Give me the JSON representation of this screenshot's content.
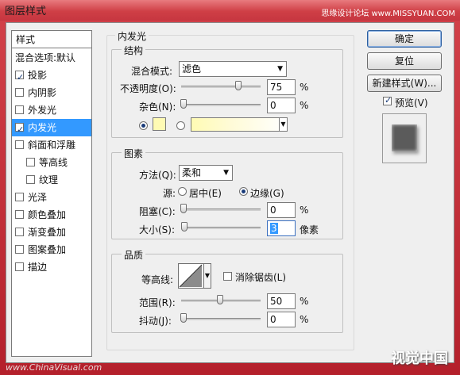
{
  "window": {
    "title": "图层样式"
  },
  "watermarks": {
    "top": "思缘设计论坛 www.MISSYUAN.COM",
    "bottom": "www.ChinaVisual.com",
    "logo": "视觉中国"
  },
  "style_list": {
    "header": "样式",
    "blend_options": "混合选项:默认",
    "items": [
      {
        "label": "投影",
        "checked": true,
        "selected": false
      },
      {
        "label": "内阴影",
        "checked": false,
        "selected": false
      },
      {
        "label": "外发光",
        "checked": false,
        "selected": false
      },
      {
        "label": "内发光",
        "checked": true,
        "selected": true
      },
      {
        "label": "斜面和浮雕",
        "checked": false,
        "selected": false
      },
      {
        "label": "等高线",
        "checked": false,
        "selected": false
      },
      {
        "label": "纹理",
        "checked": false,
        "selected": false
      },
      {
        "label": "光泽",
        "checked": false,
        "selected": false
      },
      {
        "label": "颜色叠加",
        "checked": false,
        "selected": false
      },
      {
        "label": "渐变叠加",
        "checked": false,
        "selected": false
      },
      {
        "label": "图案叠加",
        "checked": false,
        "selected": false
      },
      {
        "label": "描边",
        "checked": false,
        "selected": false
      }
    ]
  },
  "inner_glow": {
    "title": "内发光",
    "structure": {
      "title": "结构",
      "blend_mode_label": "混合模式:",
      "blend_mode_value": "滤色",
      "opacity_label": "不透明度(O):",
      "opacity_value": "75",
      "opacity_level": 0.75,
      "noise_label": "杂色(N):",
      "noise_value": "0",
      "noise_level": 0.0,
      "unit": "%",
      "color_swatch": "#fffbb4"
    },
    "elements": {
      "title": "图素",
      "method_label": "方法(Q):",
      "method_value": "柔和",
      "source_label": "源:",
      "center_label": "居中(E)",
      "edge_label": "边缘(G)",
      "choke_label": "阻塞(C):",
      "choke_value": "0",
      "choke_level": 0.0,
      "size_label": "大小(S):",
      "size_value": "3",
      "size_unit": "像素",
      "size_level": 0.015
    },
    "quality": {
      "title": "品质",
      "contour_label": "等高线:",
      "anti_alias_label": "消除锯齿(L)",
      "range_label": "范围(R):",
      "range_value": "50",
      "range_level": 0.5,
      "jitter_label": "抖动(J):",
      "jitter_value": "0",
      "jitter_level": 0.0
    }
  },
  "buttons": {
    "ok": "确定",
    "reset": "复位",
    "new_style": "新建样式(W)...",
    "preview_label": "预览(V)"
  }
}
